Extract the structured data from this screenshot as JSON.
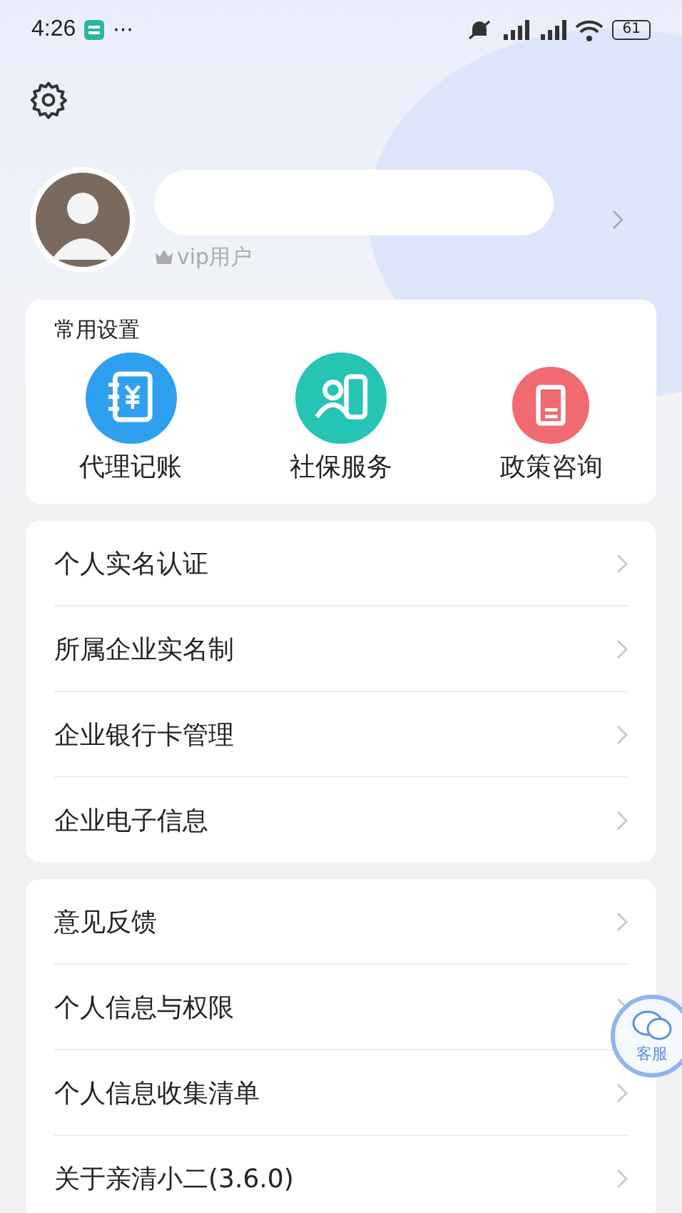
{
  "status_bar": {
    "time": "4:26",
    "more": "···",
    "battery": "61"
  },
  "profile": {
    "badge": "vip用户"
  },
  "quick_settings": {
    "title": "常用设置",
    "items": [
      {
        "label": "代理记账",
        "kind": "ledger",
        "color": "#2f9ff0"
      },
      {
        "label": "社保服务",
        "kind": "insurance",
        "color": "#25c4b4"
      },
      {
        "label": "政策咨询",
        "kind": "policy",
        "color": "#f06a72"
      }
    ]
  },
  "menu_groups": [
    {
      "items": [
        "个人实名认证",
        "所属企业实名制",
        "企业银行卡管理",
        "企业电子信息"
      ]
    },
    {
      "items": [
        "意见反馈",
        "个人信息与权限",
        "个人信息收集清单",
        "关于亲清小二(3.6.0)"
      ]
    }
  ],
  "service_button": {
    "label": "客服"
  }
}
